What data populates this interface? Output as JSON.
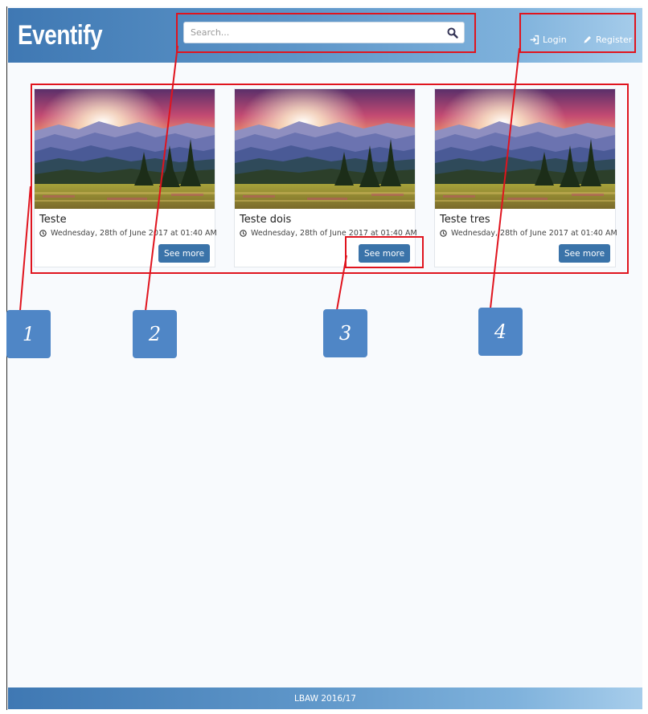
{
  "navbar": {
    "brand": "Eventify",
    "search": {
      "placeholder": "Search...",
      "value": ""
    },
    "login_label": "Login",
    "register_label": "Register"
  },
  "events": [
    {
      "title": "Teste",
      "date": "Wednesday, 28th of June 2017 at 01:40 AM",
      "button": "See more",
      "image": "mountain-sunset-photo"
    },
    {
      "title": "Teste dois",
      "date": "Wednesday, 28th of June 2017 at 01:40 AM",
      "button": "See more",
      "image": "mountain-sunset-photo"
    },
    {
      "title": "Teste tres",
      "date": "Wednesday, 28th of June 2017 at 01:40 AM",
      "button": "See more",
      "image": "mountain-sunset-photo"
    }
  ],
  "annotations": [
    "1",
    "2",
    "3",
    "4"
  ],
  "footer": {
    "text": "LBAW 2016/17"
  },
  "colors": {
    "brand_blue": "#3f78b3",
    "button_blue": "#3a73a9",
    "annotation_red": "#e0141e",
    "badge_blue": "#4f86c6"
  }
}
